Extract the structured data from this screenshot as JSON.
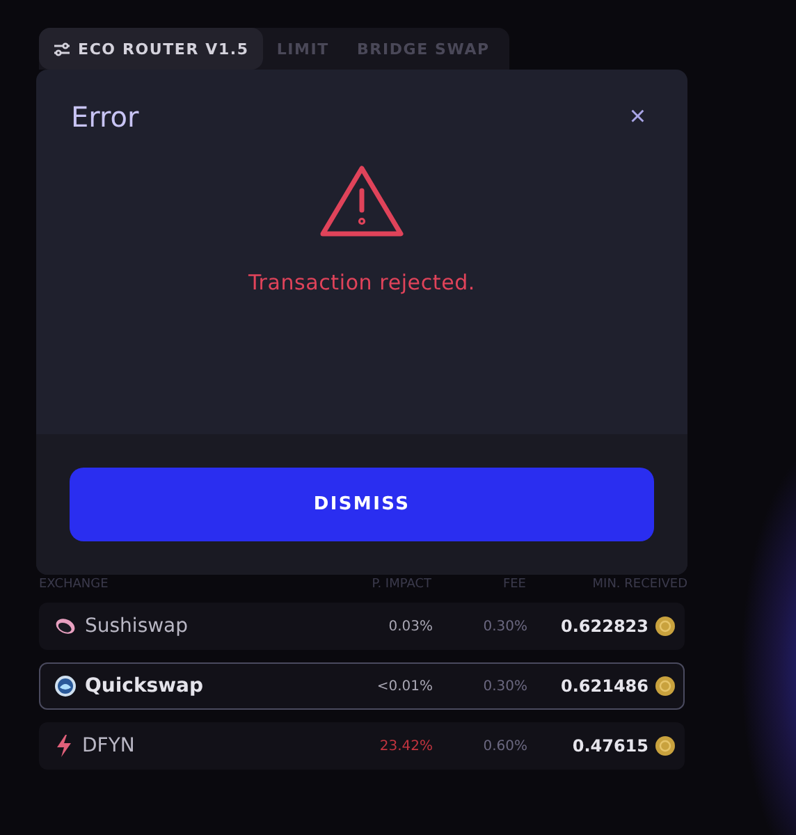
{
  "tabs": [
    {
      "label": "ECO ROUTER V1.5",
      "selected": true
    },
    {
      "label": "LIMIT",
      "selected": false
    },
    {
      "label": "BRIDGE SWAP",
      "selected": false
    }
  ],
  "dialog": {
    "title": "Error",
    "close": "×",
    "message": "Transaction rejected.",
    "button": "DISMISS"
  },
  "table": {
    "columns": [
      "EXCHANGE",
      "P. IMPACT",
      "FEE",
      "MIN. RECEIVED"
    ],
    "rows": [
      {
        "exchange": "Sushiswap",
        "impact": "0.03%",
        "high_impact": false,
        "fee": "0.30%",
        "received": "0.622823",
        "selected": false
      },
      {
        "exchange": "Quickswap",
        "impact": "<0.01%",
        "high_impact": false,
        "fee": "0.30%",
        "received": "0.621486",
        "selected": true
      },
      {
        "exchange": "DFYN",
        "impact": "23.42%",
        "high_impact": true,
        "fee": "0.60%",
        "received": "0.47615",
        "selected": false
      }
    ]
  }
}
